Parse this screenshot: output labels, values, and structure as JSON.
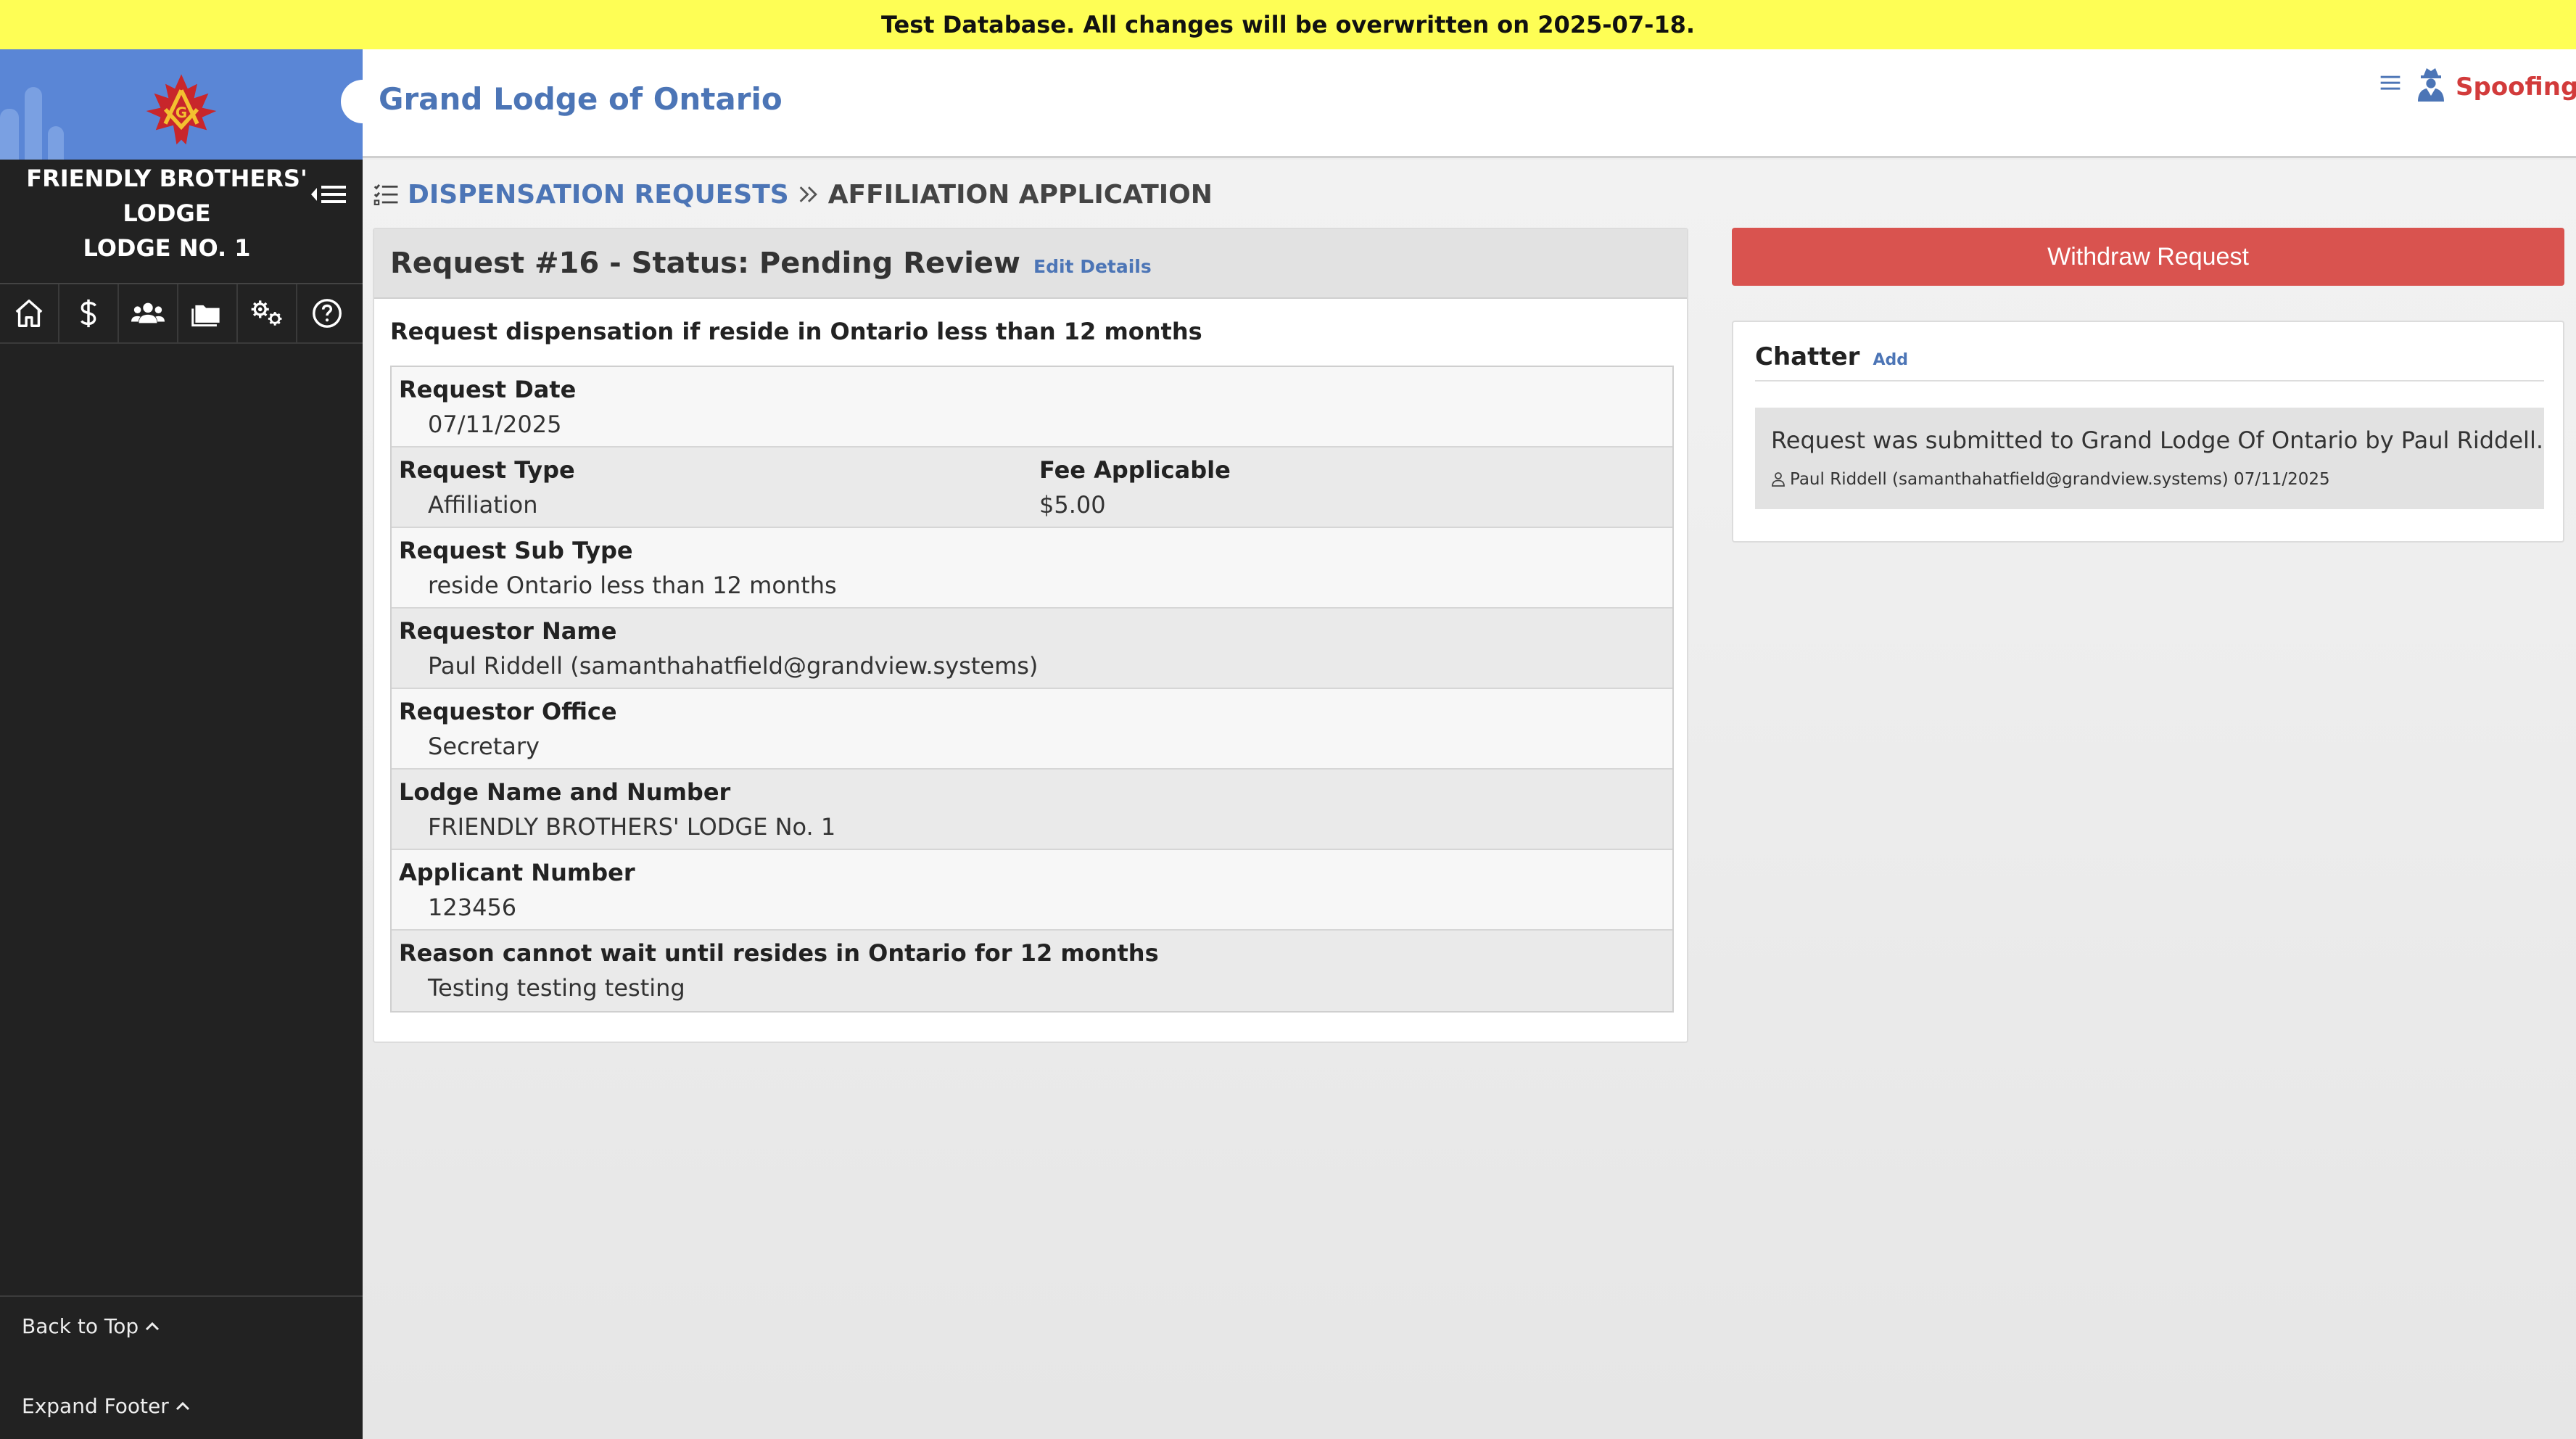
{
  "banner": {
    "text": "Test Database. All changes will be overwritten on 2025-07-18."
  },
  "sidebar": {
    "lodge_name_lines": [
      "FRIENDLY BROTHERS'",
      "LODGE",
      "LODGE NO. 1"
    ],
    "nav_icons": [
      "home-icon",
      "dollar-icon",
      "members-icon",
      "folder-icon",
      "settings-icon",
      "help-icon"
    ],
    "back_to_top": "Back to Top",
    "expand_footer": "Expand Footer"
  },
  "header": {
    "title": "Grand Lodge of Ontario",
    "spoofing": "Spoofing"
  },
  "breadcrumb": {
    "items": [
      "DISPENSATION REQUESTS",
      "AFFILIATION APPLICATION"
    ]
  },
  "request": {
    "title": "Request #16 - Status: Pending Review",
    "edit_label": "Edit Details",
    "description": "Request dispensation if reside in Ontario less than 12 months",
    "fields": [
      {
        "label": "Request Date",
        "value": "07/11/2025"
      },
      {
        "label": "Request Type",
        "value": "Affiliation",
        "label2": "Fee Applicable",
        "value2": "$5.00"
      },
      {
        "label": "Request Sub Type",
        "value": "reside Ontario less than 12 months"
      },
      {
        "label": "Requestor Name",
        "value": "Paul Riddell (samanthahatfield@grandview.systems)"
      },
      {
        "label": "Requestor Office",
        "value": "Secretary"
      },
      {
        "label": "Lodge Name and Number",
        "value": "FRIENDLY BROTHERS' LODGE No. 1"
      },
      {
        "label": "Applicant Number",
        "value": "123456"
      },
      {
        "label": "Reason cannot wait until resides in Ontario for 12 months",
        "value": "Testing testing testing"
      }
    ]
  },
  "actions": {
    "withdraw_label": "Withdraw Request"
  },
  "chatter": {
    "title": "Chatter",
    "add_label": "Add",
    "messages": [
      {
        "text": "Request was submitted to Grand Lodge Of Ontario by Paul Riddell.",
        "meta": "Paul Riddell (samanthahatfield@grandview.systems) 07/11/2025"
      }
    ]
  },
  "colors": {
    "banner": "#fefe55",
    "sidebar": "#222222",
    "sidebar_top": "#5a86d6",
    "link": "#4c75b6",
    "danger": "#d9534f",
    "spoofing": "#d23b3b"
  }
}
